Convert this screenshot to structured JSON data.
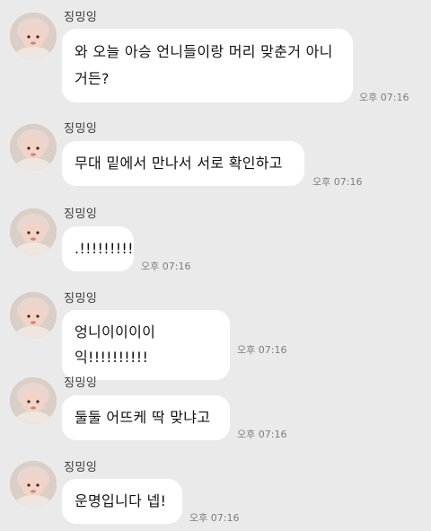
{
  "messages": [
    {
      "sender": "징밍잉",
      "text": "와 오늘 아승 언니들이랑 머리 맞춘거 아니거든?",
      "time": "오후 07:16"
    },
    {
      "sender": "징밍잉",
      "text": "무대 밑에서 만나서 서로 확인하고",
      "time": "오후 07:16"
    },
    {
      "sender": "징밍잉",
      "text": ".!!!!!!!!!",
      "time": "오후 07:16"
    },
    {
      "sender": "징밍잉",
      "text": "엉니이이이이익!!!!!!!!!!",
      "time": "오후 07:16"
    },
    {
      "sender": "징밍잉",
      "text": "둘둘 어뜨케 딱 맞냐고",
      "time": "오후 07:16"
    },
    {
      "sender": "징밍잉",
      "text": "운명입니다 넵!",
      "time": "오후 07:16"
    }
  ]
}
